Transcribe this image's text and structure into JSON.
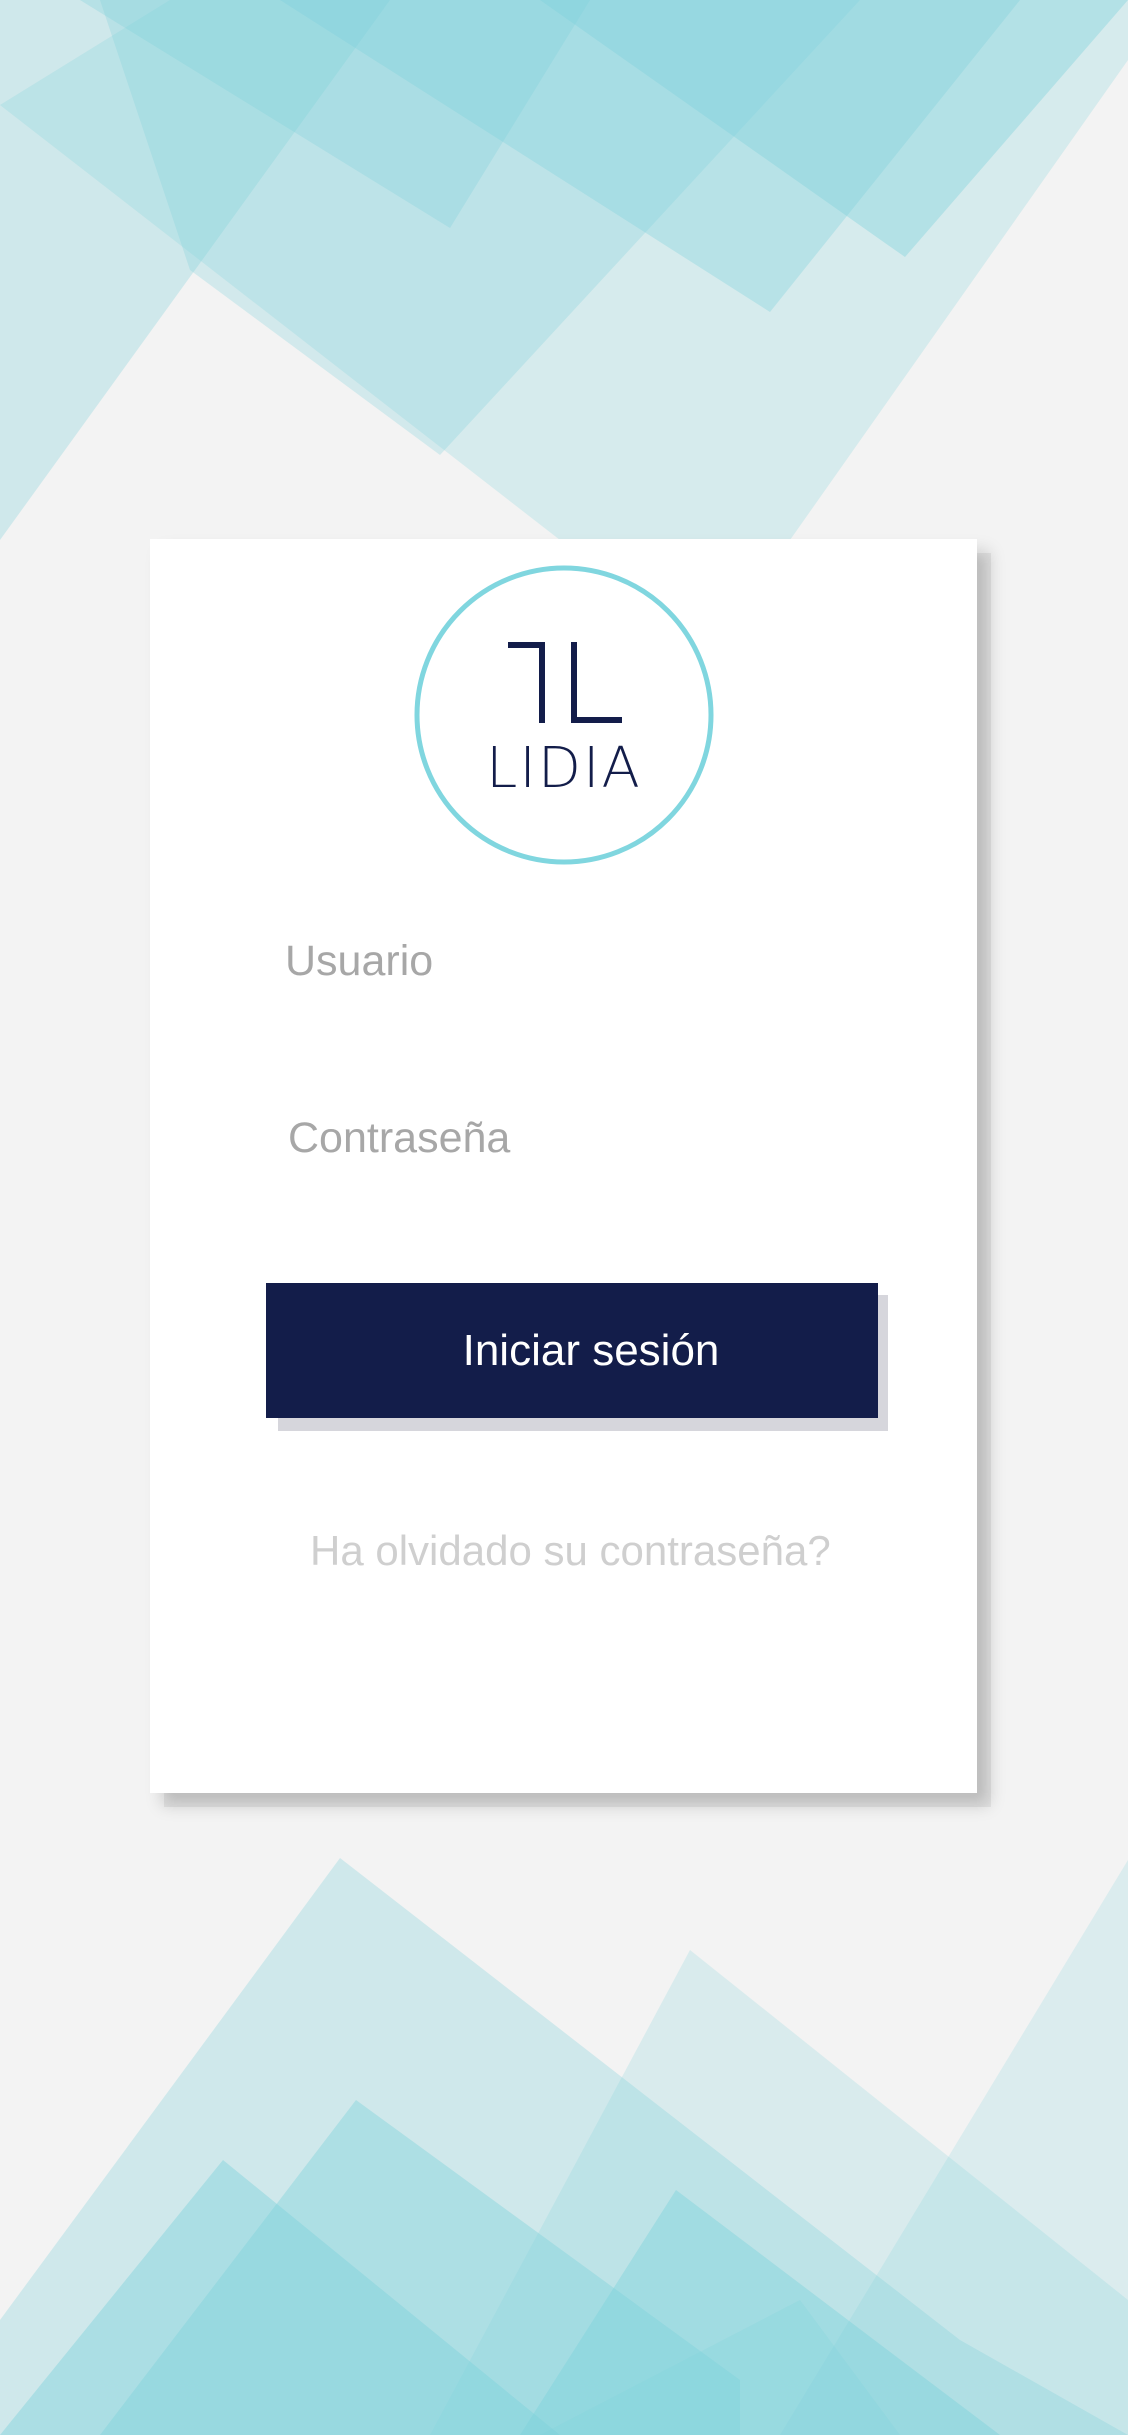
{
  "brand": {
    "name": "LIDIA",
    "logo_icon": "lidia-monogram-icon",
    "accent_color": "#80d6df",
    "primary_color": "#131d4a"
  },
  "login": {
    "username_placeholder": "Usuario",
    "password_placeholder": "Contraseña",
    "submit_label": "Iniciar sesión",
    "forgot_password_label": "Ha olvidado su contraseña?"
  }
}
